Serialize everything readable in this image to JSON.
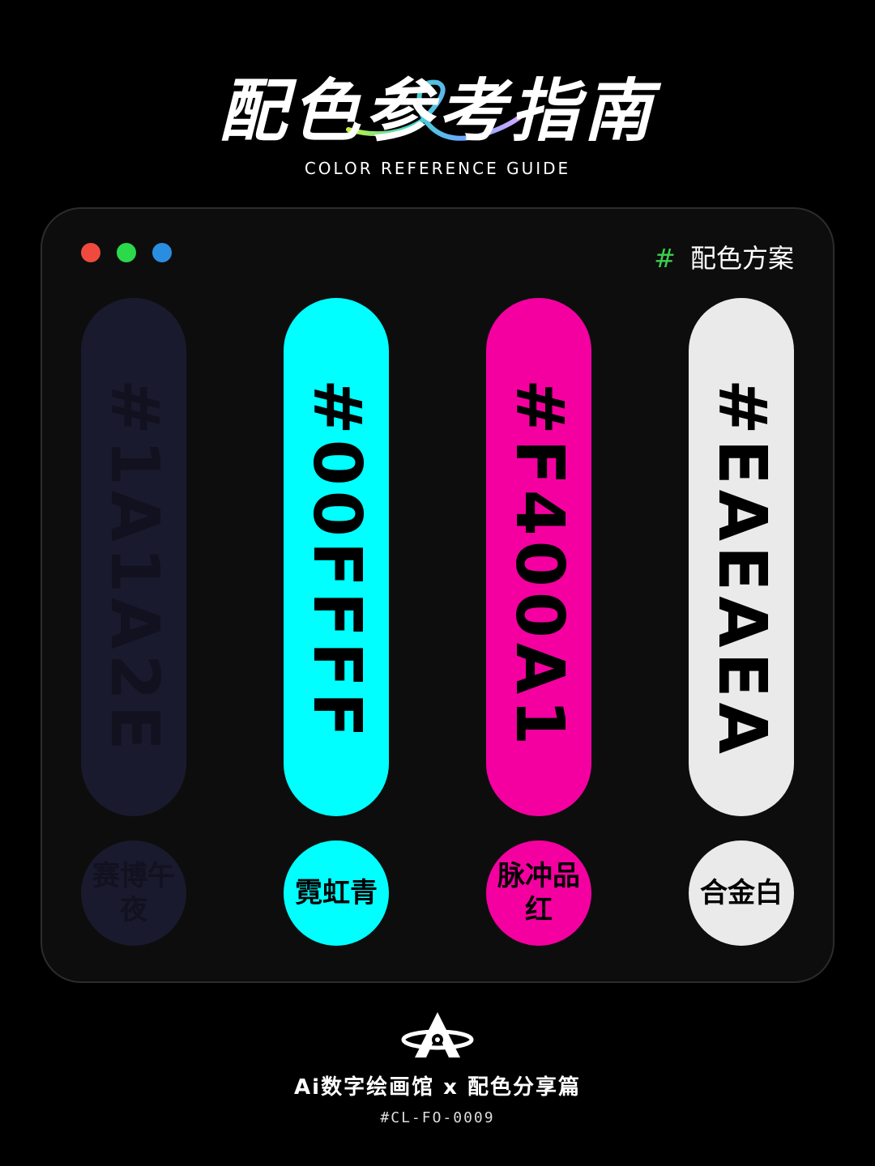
{
  "header": {
    "title": "配色参考指南",
    "subtitle": "COLOR REFERENCE GUIDE"
  },
  "window": {
    "dots": [
      "#f04a3e",
      "#2bd94a",
      "#2a8ee0"
    ],
    "scheme_hash": "#",
    "scheme_label": "配色方案",
    "hash_color": "#3ccf4e"
  },
  "swatches": [
    {
      "hex": "#1A1A2E",
      "name": "赛博午夜",
      "color": "#1A1A2E",
      "text_color": "#11111f"
    },
    {
      "hex": "#00FFFF",
      "name": "霓虹青",
      "color": "#00FFFF",
      "text_color": "#000000"
    },
    {
      "hex": "#F400A1",
      "name": "脉冲品红",
      "color": "#F400A1",
      "text_color": "#000000"
    },
    {
      "hex": "#EAEAEA",
      "name": "合金白",
      "color": "#EAEAEA",
      "text_color": "#000000"
    }
  ],
  "footer": {
    "logo_icon": "planet-a-logo-icon",
    "title": "Ai数字绘画馆 x 配色分享篇",
    "code": "#CL-FO-0009"
  }
}
